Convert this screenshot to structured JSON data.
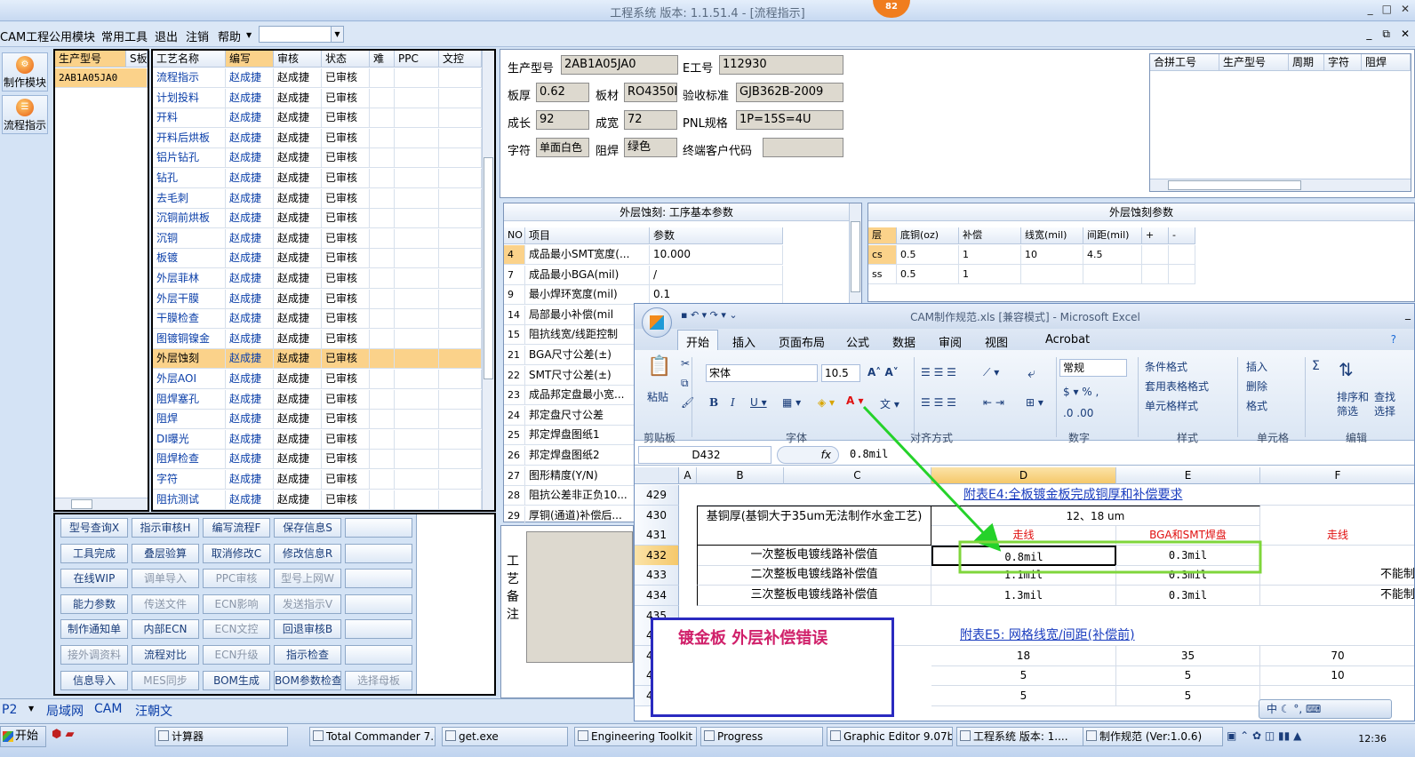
{
  "window": {
    "title": "工程系统  版本: 1.1.51.4 - [流程指示]",
    "badge": "82",
    "min": "_",
    "max": "□",
    "close": "✕"
  },
  "menu": [
    "CAM工程",
    "公用模块",
    "常用工具",
    "退出",
    "注销",
    "帮助"
  ],
  "menu_arrow": "▼",
  "mdi": {
    "min": "_",
    "restore": "⧉",
    "close": "✕"
  },
  "side": [
    {
      "label": "制作模块"
    },
    {
      "label": "流程指示"
    }
  ],
  "prod_grid": {
    "headers": [
      "生产型号",
      "S板"
    ],
    "rows": [
      [
        "2AB1A05JA0"
      ]
    ]
  },
  "process_grid": {
    "headers": [
      "工艺名称",
      "编写",
      "审核",
      "状态",
      "难",
      "PPC",
      "文控"
    ],
    "rows": [
      [
        "流程指示",
        "赵成捷",
        "赵成捷",
        "已审核"
      ],
      [
        "计划投料",
        "赵成捷",
        "赵成捷",
        "已审核"
      ],
      [
        "开料",
        "赵成捷",
        "赵成捷",
        "已审核"
      ],
      [
        "开料后烘板",
        "赵成捷",
        "赵成捷",
        "已审核"
      ],
      [
        "铝片钻孔",
        "赵成捷",
        "赵成捷",
        "已审核"
      ],
      [
        "钻孔",
        "赵成捷",
        "赵成捷",
        "已审核"
      ],
      [
        "去毛刺",
        "赵成捷",
        "赵成捷",
        "已审核"
      ],
      [
        "沉铜前烘板",
        "赵成捷",
        "赵成捷",
        "已审核"
      ],
      [
        "沉铜",
        "赵成捷",
        "赵成捷",
        "已审核"
      ],
      [
        "板镀",
        "赵成捷",
        "赵成捷",
        "已审核"
      ],
      [
        "外层菲林",
        "赵成捷",
        "赵成捷",
        "已审核"
      ],
      [
        "外层干膜",
        "赵成捷",
        "赵成捷",
        "已审核"
      ],
      [
        "干膜检查",
        "赵成捷",
        "赵成捷",
        "已审核"
      ],
      [
        "图镀铜镍金",
        "赵成捷",
        "赵成捷",
        "已审核"
      ],
      [
        "外层蚀刻",
        "赵成捷",
        "赵成捷",
        "已审核"
      ],
      [
        "外层AOI",
        "赵成捷",
        "赵成捷",
        "已审核"
      ],
      [
        "阻焊塞孔",
        "赵成捷",
        "赵成捷",
        "已审核"
      ],
      [
        "阻焊",
        "赵成捷",
        "赵成捷",
        "已审核"
      ],
      [
        "DI曝光",
        "赵成捷",
        "赵成捷",
        "已审核"
      ],
      [
        "阻焊检查",
        "赵成捷",
        "赵成捷",
        "已审核"
      ],
      [
        "字符",
        "赵成捷",
        "赵成捷",
        "已审核"
      ],
      [
        "阻抗测试",
        "赵成捷",
        "赵成捷",
        "已审核"
      ]
    ],
    "selected_row": 14
  },
  "buttons": [
    [
      "型号查询X",
      "指示审核H",
      "编写流程F",
      "保存信息S",
      ""
    ],
    [
      "工具完成",
      "叠层验算",
      "取消修改C",
      "修改信息R",
      ""
    ],
    [
      "在线WIP",
      "调单导入",
      "PPC审核",
      "型号上网W",
      ""
    ],
    [
      "能力参数",
      "传送文件",
      "ECN影响",
      "发送指示V",
      ""
    ],
    [
      "制作通知单",
      "内部ECN",
      "ECN文控",
      "回退审核B",
      ""
    ],
    [
      "接外调资料",
      "流程对比",
      "ECN升级",
      "指示检查",
      ""
    ],
    [
      "信息导入",
      "MES同步",
      "BOM生成",
      "BOM参数检查",
      "选择母板"
    ]
  ],
  "button_disabled": [
    [
      0,
      0,
      0,
      0,
      0
    ],
    [
      0,
      0,
      0,
      0,
      0
    ],
    [
      0,
      1,
      1,
      1,
      0
    ],
    [
      0,
      1,
      1,
      1,
      0
    ],
    [
      0,
      0,
      1,
      0,
      0
    ],
    [
      1,
      0,
      1,
      0,
      0
    ],
    [
      0,
      1,
      0,
      0,
      1
    ]
  ],
  "info": {
    "prod_label": "生产型号",
    "prod": "2AB1A05JA0",
    "eng_label": "E工号",
    "eng": "112930",
    "thick_label": "板厚",
    "thick": "0.62",
    "mat_label": "板材",
    "mat": "RO4350B",
    "std_label": "验收标准",
    "std": "GJB362B-2009",
    "len_label": "成长",
    "len": "92",
    "wid_label": "成宽",
    "wid": "72",
    "pnl_label": "PNL规格",
    "pnl": "1P=15S=4U",
    "char_label": "字符",
    "char": "单面白色",
    "mask_label": "阻焊",
    "mask": "绿色",
    "cust_label": "终端客户代码",
    "cust": ""
  },
  "merge_headers": [
    "合拼工号",
    "生产型号",
    "周期",
    "字符",
    "阻焊"
  ],
  "param_panel": {
    "title": "外层蚀刻: 工序基本参数",
    "headers": [
      "NO",
      "项目",
      "参数"
    ],
    "rows": [
      [
        "4",
        "成品最小SMT宽度(...",
        "10.000"
      ],
      [
        "7",
        "成品最小BGA(mil)",
        "/"
      ],
      [
        "9",
        "最小焊环宽度(mil)",
        "0.1"
      ],
      [
        "14",
        "局部最小补偿(mil",
        ""
      ],
      [
        "15",
        "阻抗线宽/线距控制",
        ""
      ],
      [
        "21",
        "BGA尺寸公差(±)",
        ""
      ],
      [
        "22",
        "SMT尺寸公差(±)",
        ""
      ],
      [
        "23",
        "成品邦定盘最小宽...",
        ""
      ],
      [
        "24",
        "邦定盘尺寸公差",
        ""
      ],
      [
        "25",
        "邦定焊盘图纸1",
        ""
      ],
      [
        "26",
        "邦定焊盘图纸2",
        ""
      ],
      [
        "27",
        "图形精度(Y/N)",
        ""
      ],
      [
        "28",
        "阻抗公差非正负10...",
        ""
      ],
      [
        "29",
        "厚铜(通道)补偿后...",
        ""
      ]
    ]
  },
  "etch_panel": {
    "title": "外层蚀刻参数",
    "headers": [
      "层",
      "底铜(oz)",
      "补偿",
      "线宽(mil)",
      "间距(mil)",
      "+",
      "-"
    ],
    "rows": [
      [
        "cs",
        "0.5",
        "1",
        "10",
        "4.5",
        "",
        ""
      ],
      [
        "ss",
        "0.5",
        "1",
        "",
        "",
        "",
        ""
      ]
    ]
  },
  "remark_label": "工艺备注",
  "excel": {
    "title": "CAM制作规范.xls [兼容模式] - Microsoft Excel",
    "tabs": [
      "开始",
      "插入",
      "页面布局",
      "公式",
      "数据",
      "审阅",
      "视图",
      "Acrobat"
    ],
    "groups": [
      "剪贴板",
      "字体",
      "对齐方式",
      "数字",
      "样式",
      "单元格",
      "编辑"
    ],
    "paste": "粘贴",
    "font": "宋体",
    "size": "10.5",
    "numfmt": "常规",
    "styles": [
      "条件格式",
      "套用表格格式",
      "单元格样式"
    ],
    "cells_ops": [
      "插入",
      "删除",
      "格式"
    ],
    "edit_ops": [
      "排序和",
      "筛选",
      "查找",
      "选择"
    ],
    "namebox": "D432",
    "fx": "fx",
    "formula": "0.8mil",
    "cols": [
      "A",
      "B",
      "C",
      "D",
      "E",
      "F"
    ],
    "rows": [
      "429",
      "430",
      "431",
      "432",
      "433",
      "434",
      "435",
      "436",
      "437",
      "438",
      "439"
    ],
    "e4_title": "附表E4:全板镀金板完成铜厚和补偿要求",
    "base_copper": "基铜厚(基铜大于35um无法制作水金工艺)",
    "copper_range": "12、18 um",
    "col_line": "走线",
    "col_bga": "BGA和SMT焊盘",
    "col_line2": "走线",
    "r432": [
      "一次整板电镀线路补偿值",
      "0.8mil",
      "0.3mil"
    ],
    "r433": [
      "二次整板电镀线路补偿值",
      "1.1mil",
      "0.3mil",
      "不能制"
    ],
    "r434": [
      "三次整板电镀线路补偿值",
      "1.3mil",
      "0.3mil",
      "不能制"
    ],
    "e5_title": "附表E5: 网格线宽/间距(补偿前)",
    "r437": [
      "18",
      "35",
      "70"
    ],
    "r438": [
      "5",
      "5",
      "10"
    ],
    "r439": [
      "5",
      "5"
    ]
  },
  "annotation": "镀金板  外层补偿错误",
  "status": {
    "p2": "P2",
    "items": [
      "局域网",
      "CAM",
      "汪朝文"
    ]
  },
  "ime": "中 ☾ °, ⌨",
  "taskbar": {
    "start": "开始",
    "tasks": [
      "计算器",
      "Total Commander 7.0...",
      "get.exe",
      "Engineering Toolkit 9....",
      "Progress",
      "Graphic Editor 9.07b2...",
      "工程系统  版本: 1....",
      "制作规范 (Ver:1.0.6)"
    ],
    "clock": "12:36"
  }
}
